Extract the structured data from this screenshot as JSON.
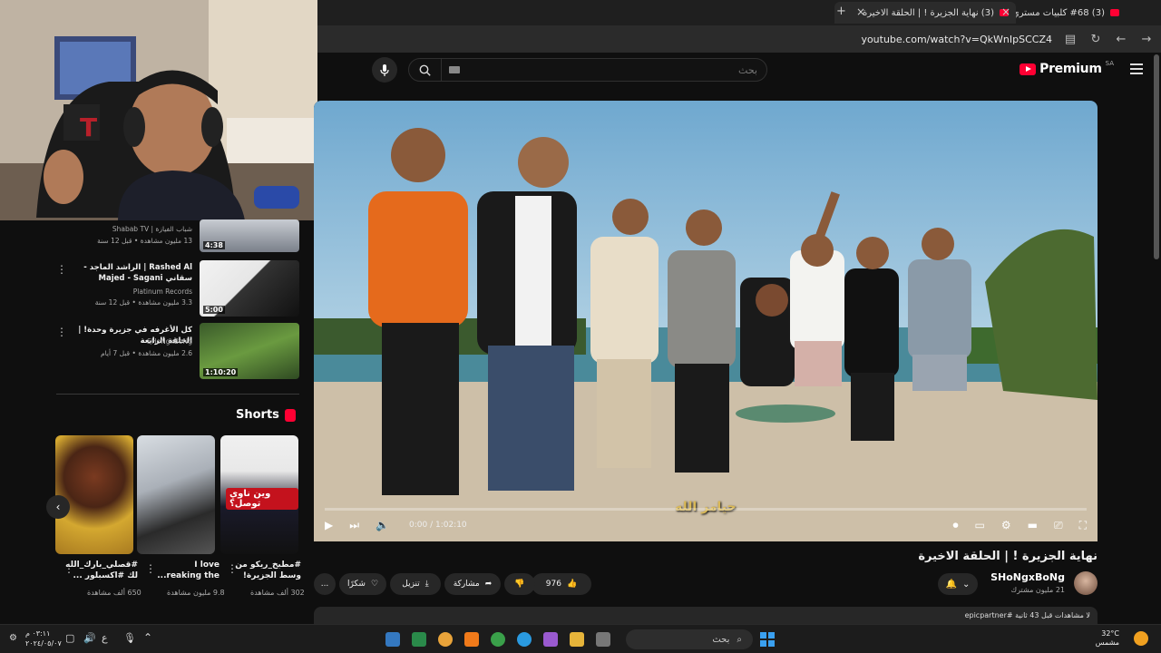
{
  "browser": {
    "tabs": [
      {
        "title": "(3) نهاية الجزيرة ! | الحلقة الاخيرة",
        "active": true
      },
      {
        "title": "(3) #68 كلبيات مستري تاون MT",
        "active": false
      }
    ],
    "url": "youtube.com/watch?v=QkWnIpSCCZ4",
    "new_tab_label": "+",
    "close_label": "×"
  },
  "header": {
    "search_placeholder": "بحث",
    "brand": "Premium",
    "region": "SA"
  },
  "player": {
    "time": "0:00 / 1:02:10",
    "subtitle": "حيامر الله"
  },
  "video": {
    "title": "نهاية الجزيرة ! | الحلقة الاخيرة",
    "channel": "SHoNgxBoNg",
    "subscribers": "21 مليون مشترك",
    "likes": "976",
    "share": "مشاركة",
    "download": "تنزيل",
    "thanks": "شكرًا",
    "more": "...",
    "description_views": "لا مشاهدات قبل 43 ثانية",
    "hashtag": "#epicpartner"
  },
  "recommended": [
    {
      "title": "",
      "channel": "شباب الفيازة | Shabab TV",
      "meta": "13 مليون مشاهدة • قبل 12 سنة",
      "duration": "4:38"
    },
    {
      "title": "Rashed Al | الراشد الماجد - سقاني Majed - Sagani",
      "channel": "Platinum Records",
      "meta": "3.3 مليون مشاهدة • قبل 12 سنة",
      "duration": "5:00"
    },
    {
      "title": "كل الأغرفه في جزيرة وحدة! | الحلقة الرابعة",
      "channel": "SHoNgxBoNg",
      "meta": "2.6 مليون مشاهدة • قبل 7 أيام",
      "duration": "1:10:20"
    }
  ],
  "shorts": {
    "heading": "Shorts",
    "items": [
      {
        "title": "#مطبخ_ريكو من وسط الجزيرة!",
        "views": "302 ألف مشاهدة",
        "overlay": "وين ناوي توصل؟"
      },
      {
        "title": "I love ...reaking the",
        "views": "9.8 مليون مشاهدة",
        "overlay": ""
      },
      {
        "title": "#قصلي_بارك_الله لك #اكسبلور ...",
        "views": "650 ألف مشاهدة",
        "overlay": ""
      }
    ]
  },
  "taskbar": {
    "search": "بحث",
    "clock_time": "٠٣:١١ م",
    "clock_date": "٢٠٢٤/٠٥/٠٧",
    "lang": "ع",
    "temperature": "32°C",
    "weather": "مشمس"
  },
  "colors": {
    "accent": "#ff0033",
    "background": "#0f0f0f",
    "surface": "#272727"
  }
}
